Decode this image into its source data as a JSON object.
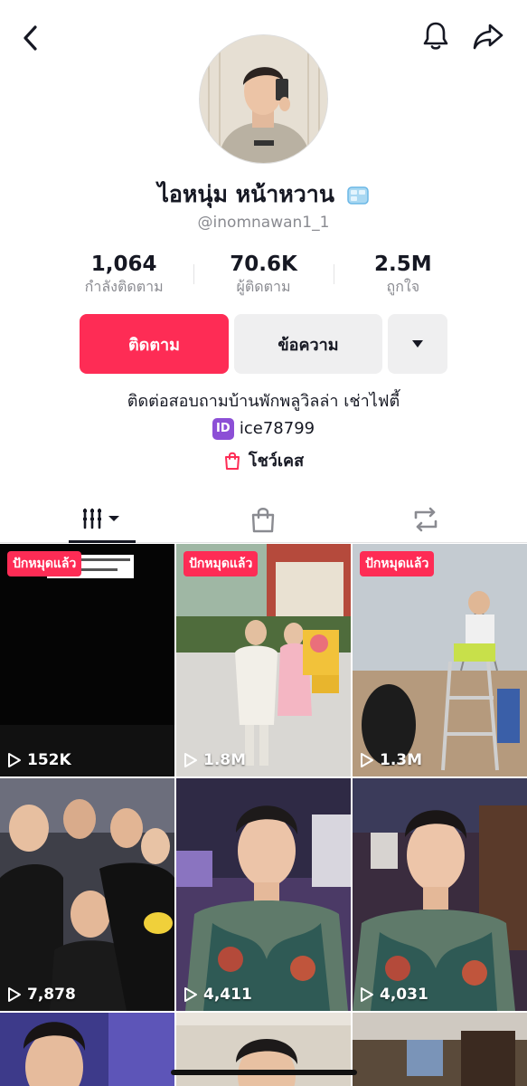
{
  "profile": {
    "display_name": "ไอหนุ่ม หน้าหวาน",
    "handle": "@inomnawan1_1"
  },
  "stats": [
    {
      "value": "1,064",
      "label": "กำลังติดตาม"
    },
    {
      "value": "70.6K",
      "label": "ผู้ติดตาม"
    },
    {
      "value": "2.5M",
      "label": "ถูกใจ"
    }
  ],
  "actions": {
    "follow_label": "ติดตาม",
    "message_label": "ข้อความ"
  },
  "bio": {
    "line1": "ติดต่อสอบถามบ้านพักพลูวิลล่า เช่าไฟตี้",
    "id_badge": "ID",
    "line2": "ice78799",
    "showcase_label": "โชว์เคส"
  },
  "videos": [
    {
      "pinned": "ปักหมุดแล้ว",
      "views": "152K"
    },
    {
      "pinned": "ปักหมุดแล้ว",
      "views": "1.8M"
    },
    {
      "pinned": "ปักหมุดแล้ว",
      "views": "1.3M"
    },
    {
      "pinned": "",
      "views": "7,878"
    },
    {
      "pinned": "",
      "views": "4,411"
    },
    {
      "pinned": "",
      "views": "4,031"
    }
  ],
  "colors": {
    "accent": "#fe2c55",
    "button_gray": "#efeff0",
    "muted_text": "#8a8b91"
  }
}
